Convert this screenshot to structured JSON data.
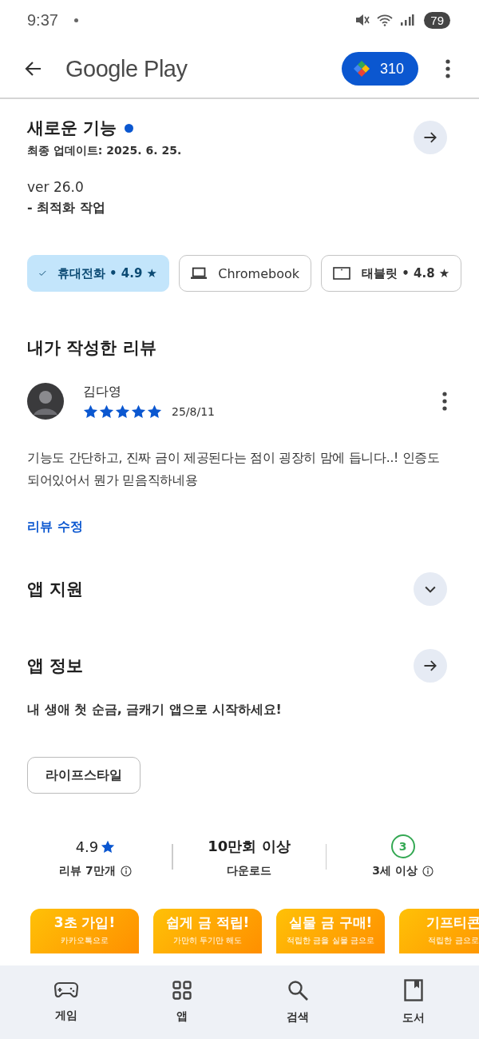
{
  "status_bar": {
    "time": "9:37",
    "battery": "79"
  },
  "app_bar": {
    "title": "Google Play",
    "points": "310"
  },
  "whats_new": {
    "title": "새로운 기능",
    "unread": true,
    "updated": "최종 업데이트: 2025. 6. 25.",
    "version": "ver 26.0",
    "notes": "- 최적화 작업"
  },
  "devices": [
    {
      "label": "휴대전화 • 4.9 ★",
      "selected": true
    },
    {
      "label": "Chromebook",
      "kind": "laptop",
      "selected": false
    },
    {
      "label": "태블릿 • 4.8 ★",
      "kind": "tablet",
      "selected": false
    }
  ],
  "my_review": {
    "heading": "내가 작성한 리뷰",
    "author": "김다영",
    "stars": 5,
    "date": "25/8/11",
    "text": "기능도 간단하고, 진짜 금이 제공된다는 점이 굉장히 맘에 듭니다..! 인증도 되어있어서 뭔가 믿음직하네용",
    "edit": "리뷰 수정"
  },
  "app_support": {
    "title": "앱 지원",
    "expanded": false
  },
  "about": {
    "title": "앱 정보",
    "description": "내 생애 첫 순금, 금캐기 앱으로 시작하세요!",
    "category": "라이프스타일"
  },
  "stats": [
    {
      "kind": "rating",
      "value": "4.9",
      "label": "리뷰 7만개"
    },
    {
      "kind": "text",
      "value": "10만회 이상",
      "label": "다운로드"
    },
    {
      "kind": "age",
      "value": "3",
      "label": "3세 이상"
    }
  ],
  "screenshots": [
    {
      "title": "3초 가입!",
      "caption": "카카오톡으로"
    },
    {
      "title": "쉽게 금 적립!",
      "caption": "가만히 두기만 해도"
    },
    {
      "title": "실물 금 구매!",
      "caption": "적립한 금을 실물 금으로"
    },
    {
      "title": "기프티콘",
      "caption": "적립한 금으로"
    }
  ],
  "bottom_nav": [
    {
      "label": "게임",
      "kind": "game",
      "selected": false
    },
    {
      "label": "앱",
      "kind": "apps",
      "selected": false
    },
    {
      "label": "검색",
      "kind": "search",
      "selected": false
    },
    {
      "label": "도서",
      "kind": "book",
      "selected": false
    }
  ]
}
